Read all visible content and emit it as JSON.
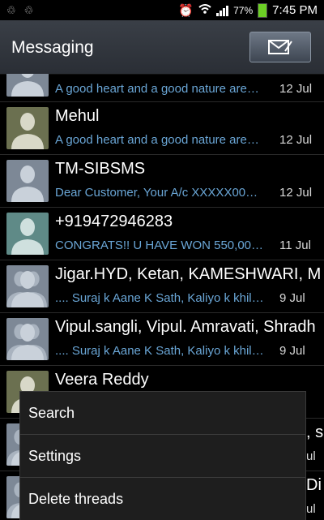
{
  "status": {
    "battery_pct": "77%",
    "time": "7:45 PM",
    "battery_color": "#6ccf25"
  },
  "app": {
    "title": "Messaging",
    "compose_icon": "compose-envelope-icon"
  },
  "threads": [
    {
      "name": "",
      "preview": "A good heart and a good nature are…",
      "date": "12 Jul",
      "avatar": "single-gray"
    },
    {
      "name": "Mehul",
      "preview": "A good heart and a good nature are…",
      "date": "12 Jul",
      "avatar": "single-olive"
    },
    {
      "name": "TM-SIBSMS",
      "preview": "Dear Customer, Your A/c XXXXX00…",
      "date": "12 Jul",
      "avatar": "single-gray"
    },
    {
      "name": "+919472946283",
      "preview": "CONGRATS!! U HAVE WON 550,00…",
      "date": "11 Jul",
      "avatar": "single-teal"
    },
    {
      "name": "Jigar.HYD, Ketan, KAMESHWARI, M",
      "preview": ".... Suraj k Aane K Sath, Kaliyo k khil…",
      "date": "9 Jul",
      "avatar": "group"
    },
    {
      "name": "Vipul.sangli, Vipul. Amravati, Shradh",
      "preview": ".... Suraj k Aane K Sath, Kaliyo k khil…",
      "date": "9 Jul",
      "avatar": "group"
    },
    {
      "name": "Veera Reddy",
      "preview": "",
      "date": "",
      "avatar": "single-olive"
    },
    {
      "name": ", s",
      "preview": "",
      "date": "ul",
      "avatar": "group"
    },
    {
      "name": "Di",
      "preview": "",
      "date": "ul",
      "avatar": "group"
    }
  ],
  "menu": {
    "items": [
      "Search",
      "Settings",
      "Delete threads"
    ]
  }
}
